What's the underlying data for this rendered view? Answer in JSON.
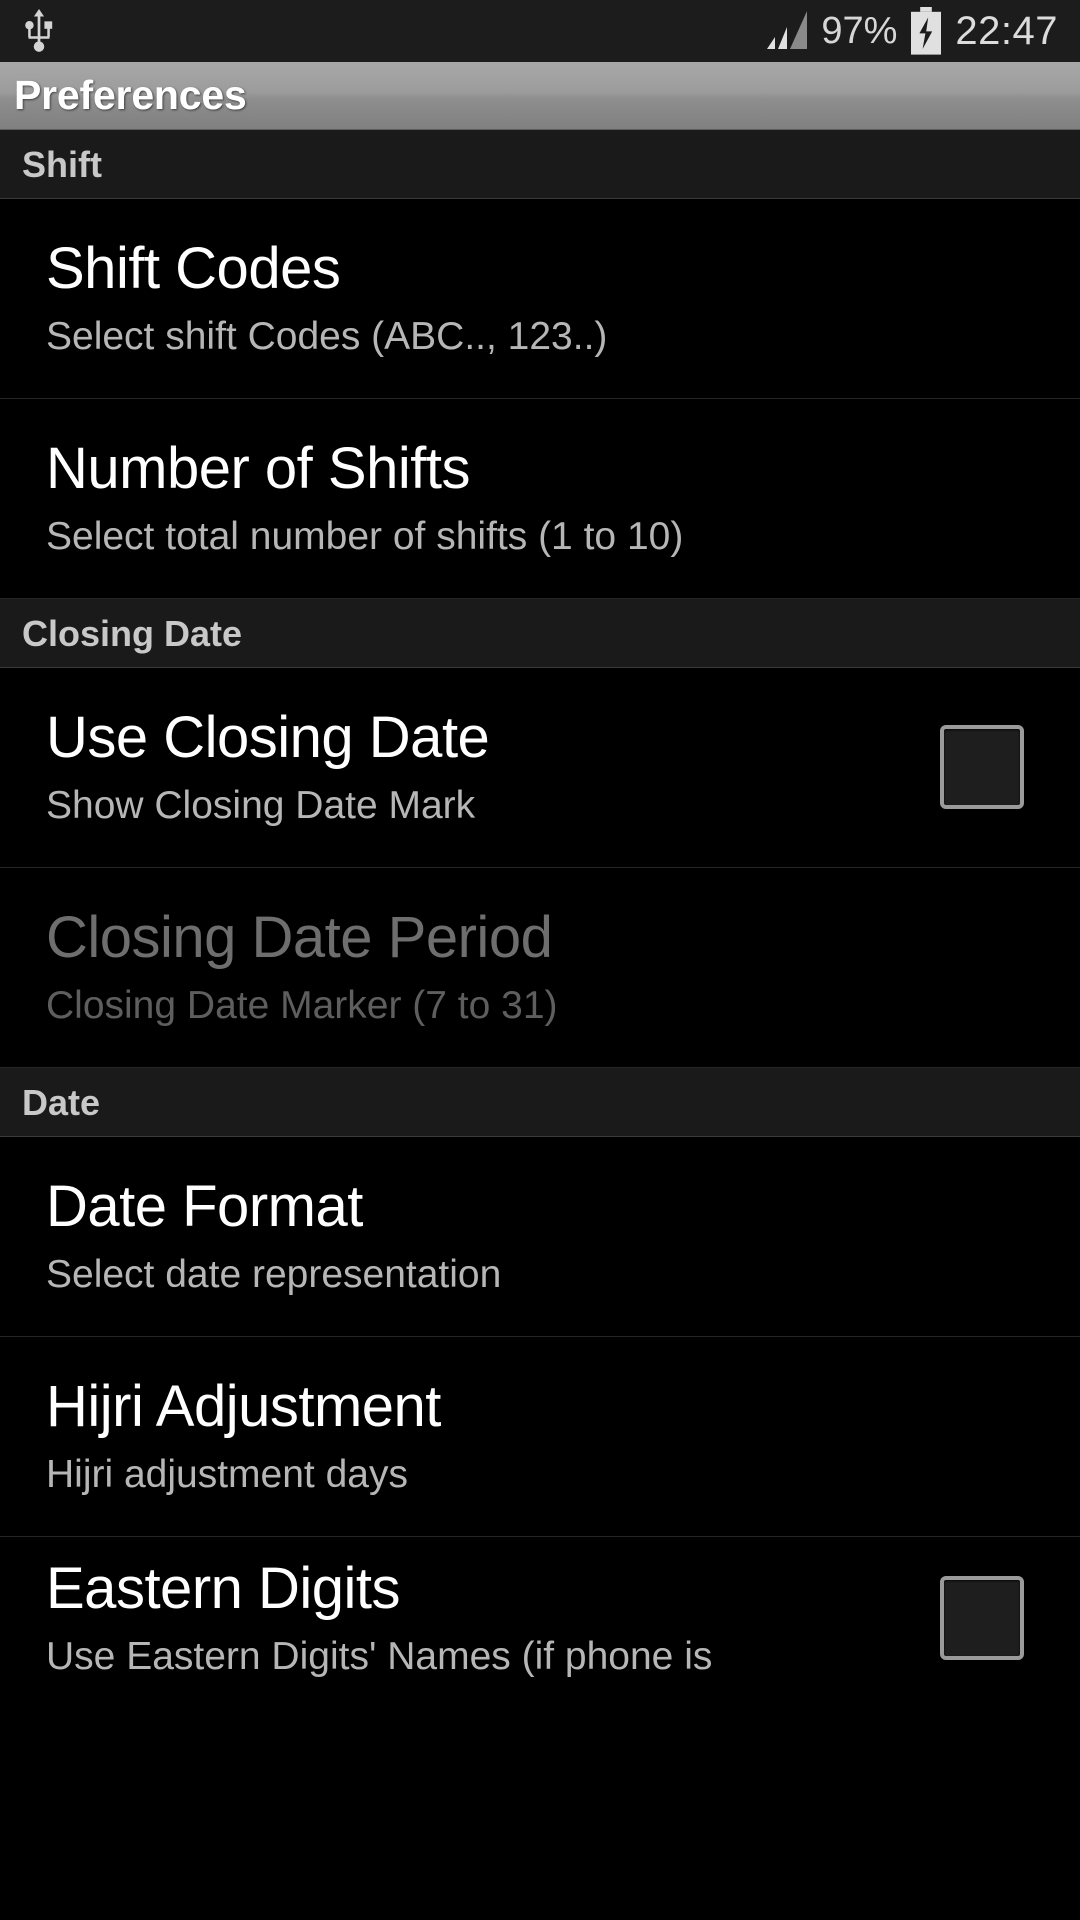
{
  "status_bar": {
    "usb_icon": "usb-icon",
    "signal_icon": "signal-bars-icon",
    "battery_percent": "97%",
    "battery_icon": "battery-charging-icon",
    "clock": "22:47"
  },
  "title_bar": {
    "title": "Preferences"
  },
  "sections": [
    {
      "header": "Shift",
      "items": [
        {
          "title": "Shift Codes",
          "summary": "Select shift Codes (ABC.., 123..)",
          "widget": "none",
          "enabled": true
        },
        {
          "title": "Number of Shifts",
          "summary": "Select total number of shifts (1 to 10)",
          "widget": "none",
          "enabled": true
        }
      ]
    },
    {
      "header": "Closing Date",
      "items": [
        {
          "title": "Use Closing Date",
          "summary": "Show Closing Date Mark",
          "widget": "checkbox",
          "checked": false,
          "enabled": true
        },
        {
          "title": "Closing Date Period",
          "summary": "Closing Date Marker (7 to 31)",
          "widget": "none",
          "enabled": false
        }
      ]
    },
    {
      "header": "Date",
      "items": [
        {
          "title": "Date Format",
          "summary": "Select date representation",
          "widget": "none",
          "enabled": true
        },
        {
          "title": "Hijri Adjustment",
          "summary": "Hijri adjustment days",
          "widget": "none",
          "enabled": true
        },
        {
          "title": "Eastern Digits",
          "summary": "Use Eastern Digits' Names (if phone is",
          "widget": "checkbox",
          "checked": false,
          "enabled": true
        }
      ]
    }
  ],
  "colors": {
    "background": "#000000",
    "section_header_bg": "#1a1a1a",
    "title_bar_top": "#a8a8a8",
    "title_text": "#ffffff",
    "summary_text": "#b6b6b6",
    "disabled_text": "#6e6e6e",
    "checkbox_border": "#9a9a9a"
  }
}
